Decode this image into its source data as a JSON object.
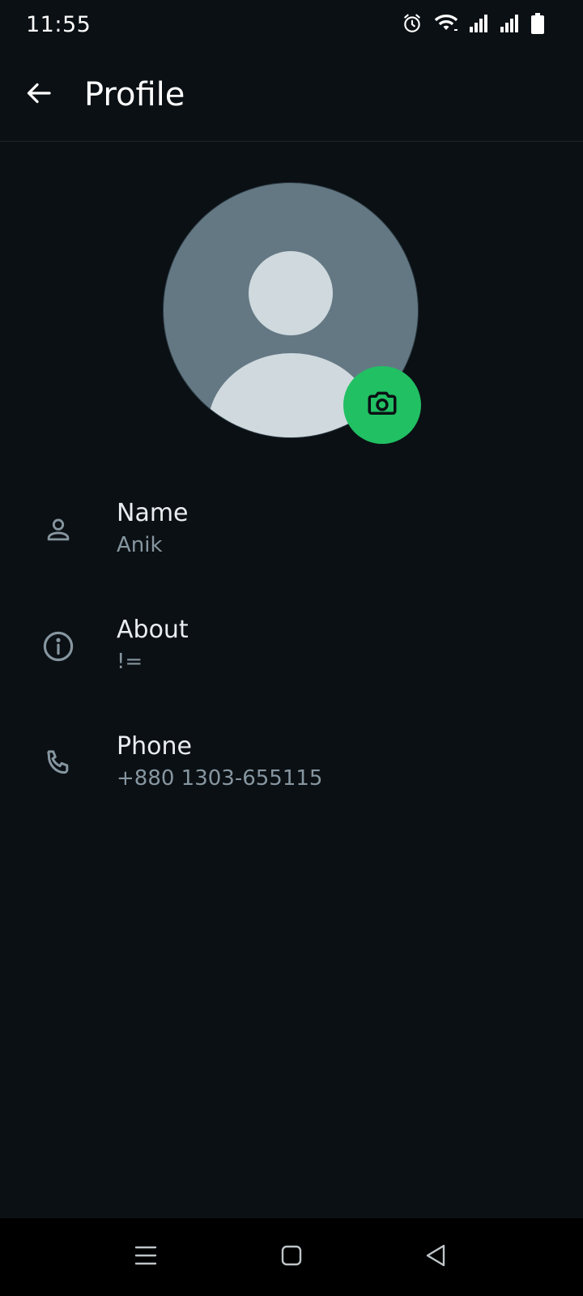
{
  "status_bar": {
    "time": "11:55",
    "icons": [
      "alarm-icon",
      "wifi-icon",
      "signal-icon",
      "signal-icon",
      "battery-icon"
    ]
  },
  "app_bar": {
    "title": "Profile",
    "back_icon": "arrow-left-icon"
  },
  "profile": {
    "avatar_icon": "default-avatar",
    "camera_icon": "camera-icon",
    "rows": [
      {
        "icon": "person-icon",
        "title": "Name",
        "value": "Anik"
      },
      {
        "icon": "info-icon",
        "title": "About",
        "value": "!="
      },
      {
        "icon": "phone-icon",
        "title": "Phone",
        "value": "+880 1303-655115"
      }
    ]
  },
  "nav_bar": {
    "buttons": [
      "menu-icon",
      "home-icon",
      "back-triangle-icon"
    ]
  },
  "colors": {
    "background": "#0b1014",
    "accent": "#21c063",
    "avatar_bg": "#647884",
    "secondary_text": "#8696a0"
  }
}
